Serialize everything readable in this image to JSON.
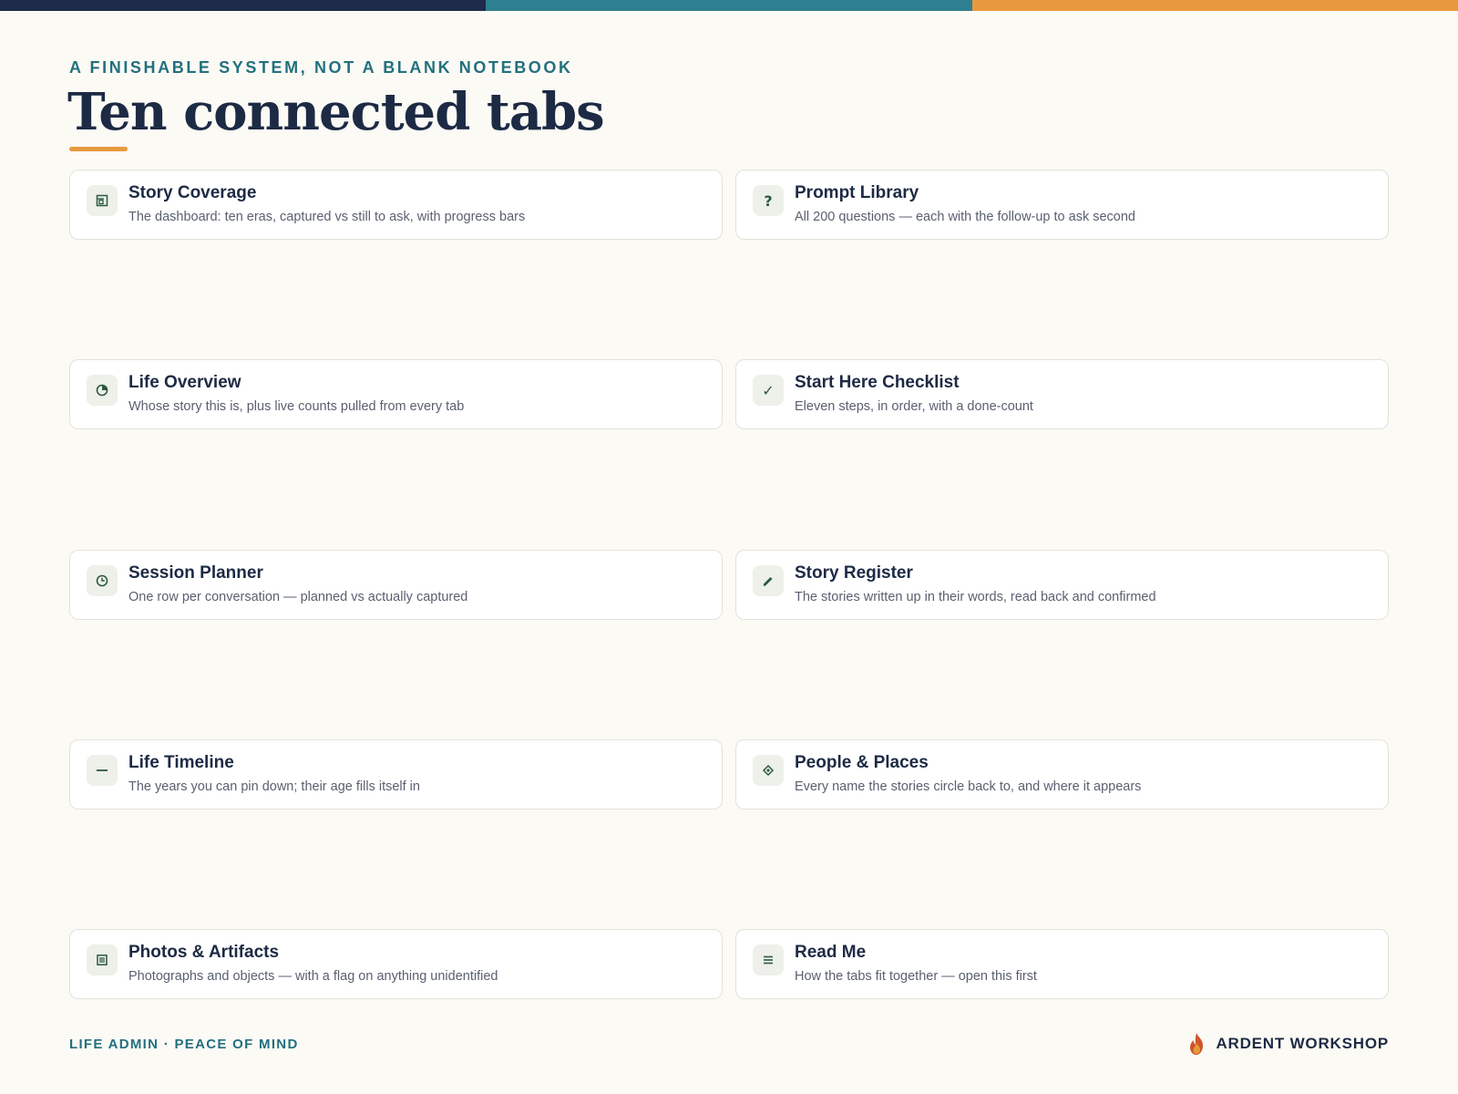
{
  "header": {
    "eyebrow": "A FINISHABLE SYSTEM, NOT A BLANK NOTEBOOK",
    "title": "Ten connected tabs"
  },
  "colors": {
    "navy": "#1f2b4a",
    "teal": "#2e7f8f",
    "orange": "#e8993d",
    "icon_green": "#2c5a3e"
  },
  "tabs": [
    {
      "name": "Story Coverage",
      "desc": "The dashboard: ten eras, captured vs still to ask, with progress bars",
      "icon": "dashboard-icon"
    },
    {
      "name": "Prompt Library",
      "desc": "All 200 questions — each with the follow-up to ask second",
      "icon": "question-icon"
    },
    {
      "name": "Life Overview",
      "desc": "Whose story this is, plus live counts pulled from every tab",
      "icon": "pie-icon"
    },
    {
      "name": "Start Here Checklist",
      "desc": "Eleven steps, in order, with a done-count",
      "icon": "check-icon"
    },
    {
      "name": "Session Planner",
      "desc": "One row per conversation — planned vs actually captured",
      "icon": "clock-icon"
    },
    {
      "name": "Story Register",
      "desc": "The stories written up in their words, read back and confirmed",
      "icon": "pen-icon"
    },
    {
      "name": "Life Timeline",
      "desc": "The years you can pin down; their age fills itself in",
      "icon": "timeline-icon"
    },
    {
      "name": "People & Places",
      "desc": "Every name the stories circle back to, and where it appears",
      "icon": "diamond-icon"
    },
    {
      "name": "Photos & Artifacts",
      "desc": "Photographs and objects — with a flag on anything unidentified",
      "icon": "photo-icon"
    },
    {
      "name": "Read Me",
      "desc": "How the tabs fit together — open this first",
      "icon": "menu-icon"
    }
  ],
  "footer": {
    "tagline": "LIFE ADMIN · PEACE OF MIND",
    "brand": "ARDENT WORKSHOP"
  }
}
